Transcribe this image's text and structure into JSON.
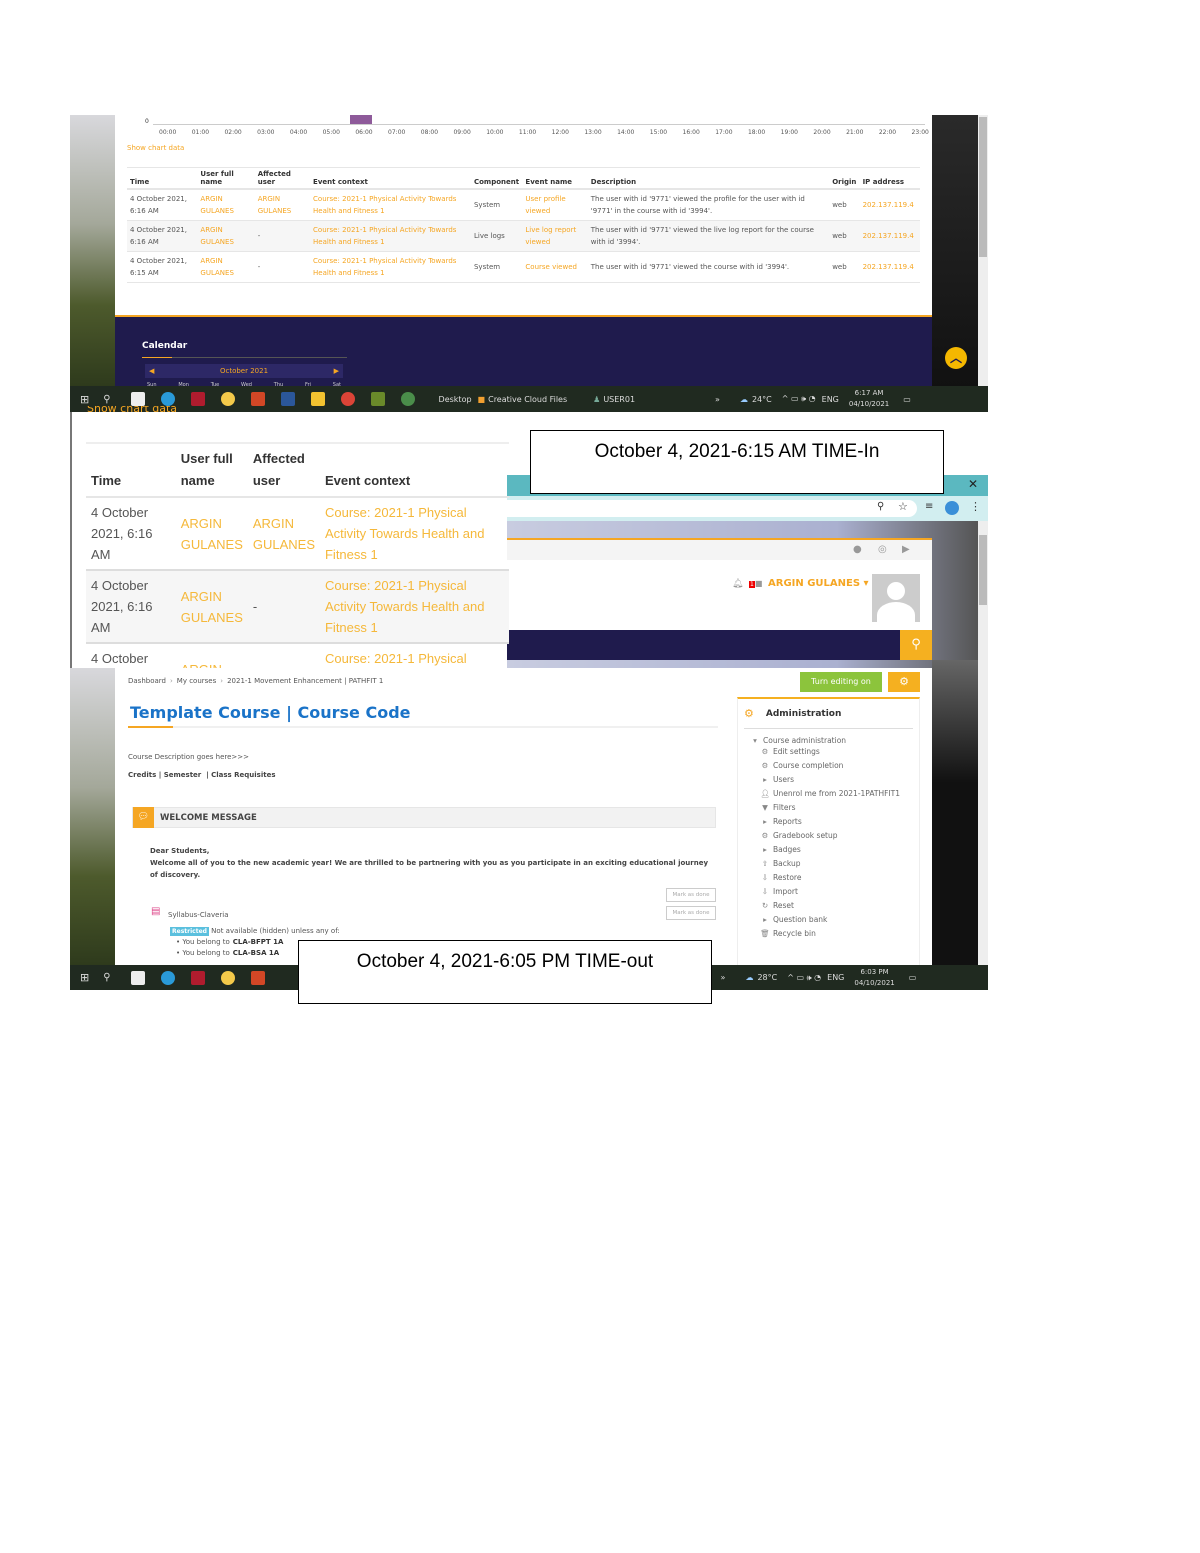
{
  "log_chart": {
    "y_tick": "0",
    "hours": [
      "00:00",
      "01:00",
      "02:00",
      "03:00",
      "04:00",
      "05:00",
      "06:00",
      "07:00",
      "08:00",
      "09:00",
      "10:00",
      "11:00",
      "12:00",
      "13:00",
      "14:00",
      "15:00",
      "16:00",
      "17:00",
      "18:00",
      "19:00",
      "20:00",
      "21:00",
      "22:00",
      "23:00"
    ],
    "active_hour": "06:00",
    "bar_color": "#8e5a9a",
    "show_chart_data": "Show chart data"
  },
  "log_table": {
    "headers": {
      "time": "Time",
      "user": "User full name",
      "affected": "Affected user",
      "context": "Event context",
      "component": "Component",
      "event": "Event name",
      "description": "Description",
      "origin": "Origin",
      "ip": "IP address"
    },
    "rows": [
      {
        "time": "4 October 2021, 6:16 AM",
        "user": "ARGIN GULANES",
        "affected": "ARGIN GULANES",
        "context": "Course: 2021-1 Physical Activity Towards Health and Fitness 1",
        "component": "System",
        "event": "User profile viewed",
        "description": "The user with id '9771' viewed the profile for the user with id '9771' in the course with id '3994'.",
        "origin": "web",
        "ip": "202.137.119.4"
      },
      {
        "time": "4 October 2021, 6:16 AM",
        "user": "ARGIN GULANES",
        "affected": "-",
        "context": "Course: 2021-1 Physical Activity Towards Health and Fitness 1",
        "component": "Live logs",
        "event": "Live log report viewed",
        "description": "The user with id '9771' viewed the live log report for the course with id '3994'.",
        "origin": "web",
        "ip": "202.137.119.4"
      },
      {
        "time": "4 October 2021, 6:15 AM",
        "user": "ARGIN GULANES",
        "affected": "-",
        "context": "Course: 2021-1 Physical Activity Towards Health and Fitness 1",
        "component": "System",
        "event": "Course viewed",
        "description": "The user with id '9771' viewed the course with id '3994'.",
        "origin": "web",
        "ip": "202.137.119.4"
      }
    ]
  },
  "calendar": {
    "title": "Calendar",
    "month": "October 2021",
    "days": [
      "Sun",
      "Mon",
      "Tue",
      "Wed",
      "Thu",
      "Fri",
      "Sat"
    ]
  },
  "taskbar1": {
    "desktop": "Desktop",
    "cc": "Creative Cloud Files",
    "user": "USER01",
    "chevron": "»",
    "temp": "24°C",
    "lang": "ENG",
    "time": "6:17 AM",
    "date": "04/10/2021"
  },
  "taskbar2": {
    "chevron": "»",
    "temp": "28°C",
    "lang": "ENG",
    "time": "6:03 PM",
    "date": "04/10/2021"
  },
  "notes": {
    "time_in": "October 4, 2021-6:15 AM TIME-In",
    "time_out": "October 4, 2021-6:05 PM TIME-out"
  },
  "header": {
    "user_name": "ARGIN GULANES",
    "notification_count": "1"
  },
  "breadcrumb": [
    "Dashboard",
    "My courses",
    "2021-1 Movement Enhancement | PATHFIT 1"
  ],
  "course": {
    "title": "Template Course | Course Code",
    "description": "Course Description goes here>>>",
    "meta": "Credits | Semester  | Class Requisites",
    "section": "WELCOME MESSAGE",
    "greeting": "Dear Students,",
    "welcome": "Welcome all of you to the new academic year! We are thrilled to be partnering with you as you participate in an exciting educational journey of discovery.",
    "mark_done": "Mark as done",
    "resource": "Syllabus-Claveria",
    "restricted": "Restricted",
    "restricted_text": "Not available (hidden) unless any of:",
    "conditions_prefix": "You belong to",
    "conditions": [
      "CLA-BFPT 1A",
      "CLA-BSA 1A"
    ]
  },
  "editing": {
    "turn_on": "Turn editing on"
  },
  "admin": {
    "title": "Administration",
    "root": "Course administration",
    "items": [
      {
        "icon": "gear",
        "label": "Edit settings"
      },
      {
        "icon": "gear",
        "label": "Course completion"
      },
      {
        "icon": "caret",
        "label": "Users"
      },
      {
        "icon": "user",
        "label": "Unenrol me from 2021-1PATHFIT1"
      },
      {
        "icon": "filter",
        "label": "Filters"
      },
      {
        "icon": "caret",
        "label": "Reports"
      },
      {
        "icon": "gear",
        "label": "Gradebook setup"
      },
      {
        "icon": "caret",
        "label": "Badges"
      },
      {
        "icon": "upload",
        "label": "Backup"
      },
      {
        "icon": "download",
        "label": "Restore"
      },
      {
        "icon": "download",
        "label": "Import"
      },
      {
        "icon": "reset",
        "label": "Reset"
      },
      {
        "icon": "caret",
        "label": "Question bank"
      },
      {
        "icon": "trash",
        "label": "Recycle bin"
      }
    ]
  },
  "colors": {
    "accent": "#f5a623",
    "navy": "#1f1b4d",
    "link_blue": "#1a73c8",
    "green": "#8cc43c",
    "teal": "#5bb8c0"
  }
}
